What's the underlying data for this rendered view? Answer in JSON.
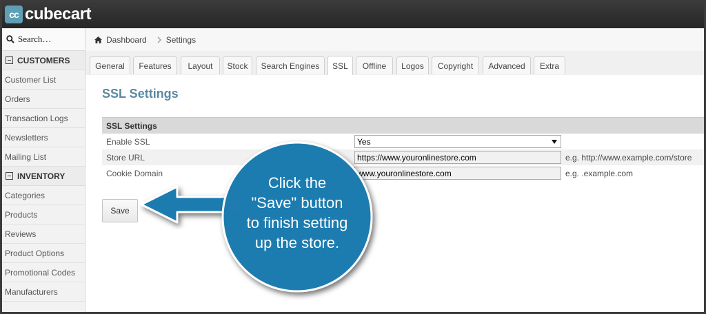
{
  "app": {
    "logo_mark": "cc",
    "logo_text": "cubecart"
  },
  "sidebar": {
    "search_placeholder": "Search…",
    "sections": [
      {
        "title": "CUSTOMERS",
        "items": [
          "Customer List",
          "Orders",
          "Transaction Logs",
          "Newsletters",
          "Mailing List"
        ]
      },
      {
        "title": "INVENTORY",
        "items": [
          "Categories",
          "Products",
          "Reviews",
          "Product Options",
          "Promotional Codes",
          "Manufacturers"
        ]
      }
    ]
  },
  "breadcrumb": {
    "home": "Dashboard",
    "current": "Settings"
  },
  "tabs": [
    "General",
    "Features",
    "Layout",
    "Stock",
    "Search Engines",
    "SSL",
    "Offline",
    "Logos",
    "Copyright",
    "Advanced",
    "Extra"
  ],
  "active_tab": "SSL",
  "main": {
    "title": "SSL Settings",
    "table_header": "SSL Settings",
    "enable_ssl": {
      "label": "Enable SSL",
      "value": "Yes"
    },
    "store_url": {
      "label": "Store URL",
      "value": "https://www.youronlinestore.com",
      "hint": "e.g. http://www.example.com/store"
    },
    "cookie_domain": {
      "label": "Cookie Domain",
      "value": "www.youronlinestore.com",
      "hint": "e.g. .example.com"
    },
    "save_label": "Save"
  },
  "callout": {
    "lines": [
      "Click the",
      "\"Save\" button",
      "to finish setting",
      "up the store."
    ],
    "color": "#1f7bb0"
  },
  "colors": {
    "accent": "#5a8aa2",
    "topbar": "#2b2b2b",
    "logo": "#5e9fb5"
  }
}
